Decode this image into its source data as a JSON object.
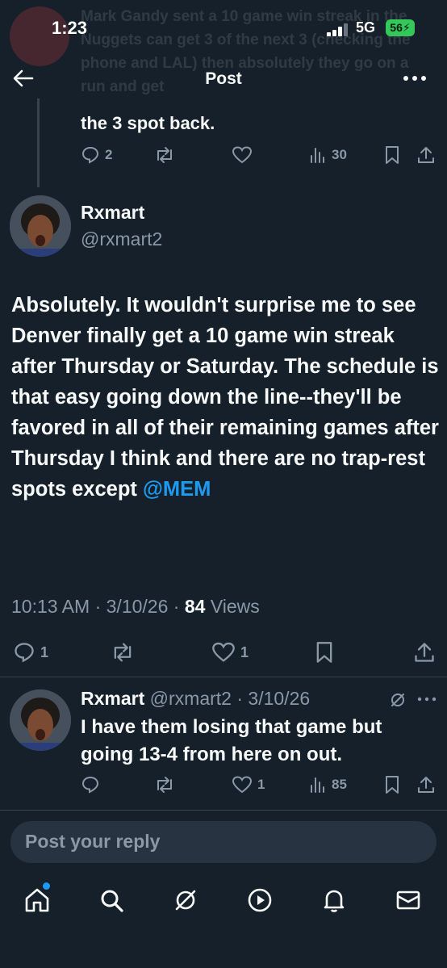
{
  "status": {
    "time": "1:23",
    "network": "5G",
    "battery": "56"
  },
  "ghost": {
    "text": "Mark Gandy sent a 10 game win streak in the Nuggets can get 3 of the next 3 (checking the phone and LAL) then absolutely they go on a run and get"
  },
  "topbar": {
    "title": "Post"
  },
  "prev_tweet": {
    "text": "the 3 spot back.",
    "replies": "2",
    "views": "30"
  },
  "main_tweet": {
    "name": "Rxmart",
    "handle": "@rxmart2",
    "body": "Absolutely.  It wouldn't surprise me to see Denver finally get a 10 game win streak after Thursday or Saturday.  The schedule is that easy going down the line--they'll be favored in all of their remaining games after Thursday I think and there are no trap-rest spots except ",
    "mention": "@MEM",
    "time": "10:13 AM",
    "date": "3/10/26",
    "views_count": "84",
    "views_label": "Views",
    "replies": "1",
    "likes": "1"
  },
  "reply_tweet": {
    "name": "Rxmart",
    "handle": "@rxmart2",
    "date": "3/10/26",
    "text": "I have them losing that game but going 13-4 from here on out.",
    "likes": "1",
    "views": "85"
  },
  "compose": {
    "placeholder": "Post your reply"
  },
  "colors": {
    "background": "#15202b",
    "accent": "#1d9bf0",
    "muted": "#8b98a5",
    "battery": "#34c759"
  },
  "nav": [
    "home-icon",
    "search-icon",
    "grok-icon",
    "video-icon",
    "notifications-icon",
    "messages-icon"
  ]
}
